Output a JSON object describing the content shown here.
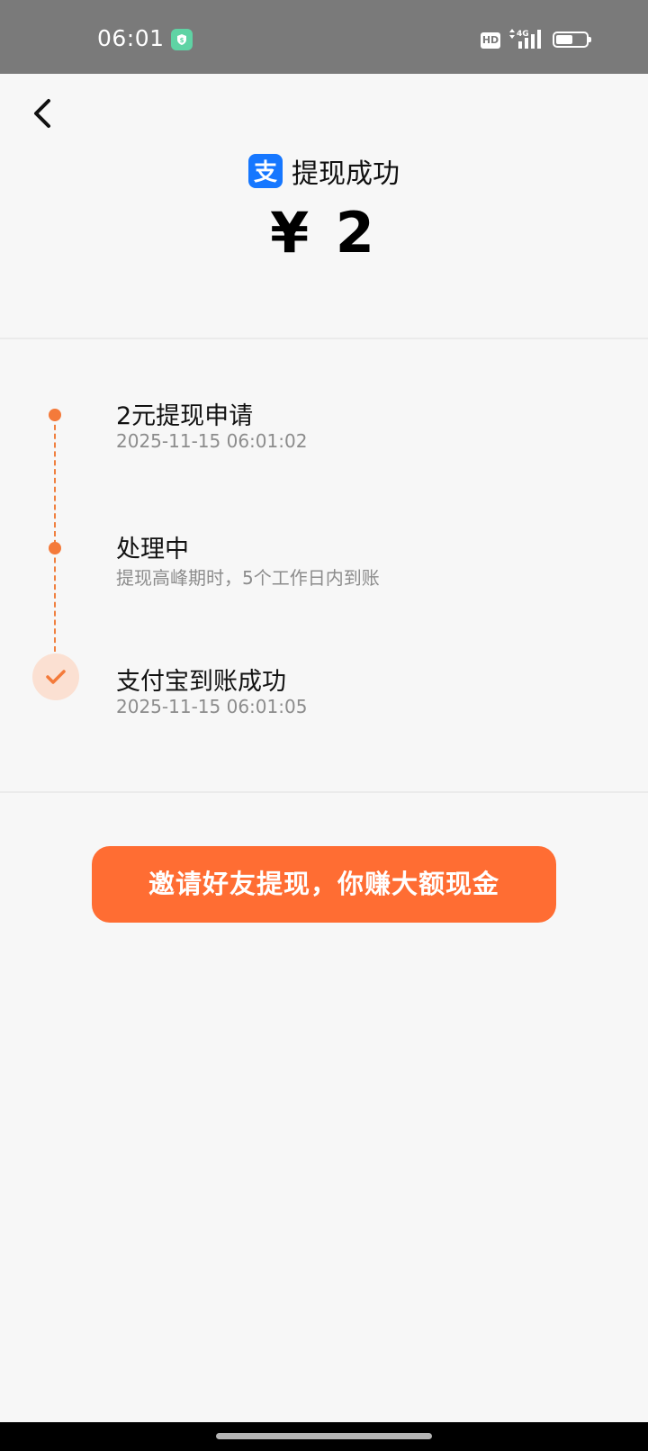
{
  "status_bar": {
    "time": "06:01",
    "hd_label": "HD",
    "network": "4G",
    "app_icon": "shield-dollar-icon",
    "battery_level": 0.55
  },
  "header": {
    "back_icon": "chevron-left-icon",
    "brand_icon": "alipay-icon",
    "brand_glyph": "支",
    "title": "提现成功",
    "amount": "¥ 2"
  },
  "timeline": {
    "steps": [
      {
        "title": "2元提现申请",
        "subtitle": "2025-11-15 06:01:02"
      },
      {
        "title": "处理中",
        "subtitle": "提现高峰期时，5个工作日内到账"
      },
      {
        "title": "支付宝到账成功",
        "subtitle": "2025-11-15 06:01:05"
      }
    ]
  },
  "cta": {
    "label": "邀请好友提现，你赚大额现金"
  },
  "colors": {
    "accent": "#ff6d33",
    "timeline": "#f47a3a",
    "alipay_blue": "#1677ff"
  }
}
